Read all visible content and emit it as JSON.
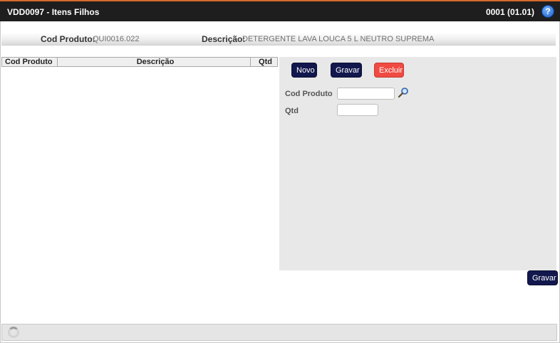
{
  "window": {
    "title": "VDD0097 - Itens Filhos",
    "code": "0001 (01.01)",
    "help_symbol": "?"
  },
  "info": {
    "cod_produto_label": "Cod Produto:",
    "cod_produto_value": "QUI0016.022",
    "descricao_label": "Descrição:",
    "descricao_value": "DETERGENTE LAVA LOUCA 5 L NEUTRO SUPREMA"
  },
  "grid": {
    "columns": [
      "Cod Produto",
      "Descrição",
      "Qtd"
    ],
    "rows": []
  },
  "form": {
    "buttons": {
      "novo": "Novo",
      "gravar": "Gravar",
      "excluir": "Excluir"
    },
    "fields": {
      "cod_produto_label": "Cod Produto",
      "qtd_label": "Qtd",
      "cod_produto_value": "",
      "qtd_value": ""
    }
  },
  "bottom": {
    "gravar": "Gravar"
  },
  "colors": {
    "titlebar": "#1e1e1e",
    "button_dark": "#12184d",
    "button_red": "#f04a43"
  },
  "icons": [
    "help-icon",
    "search-icon",
    "loading-spinner-icon"
  ]
}
